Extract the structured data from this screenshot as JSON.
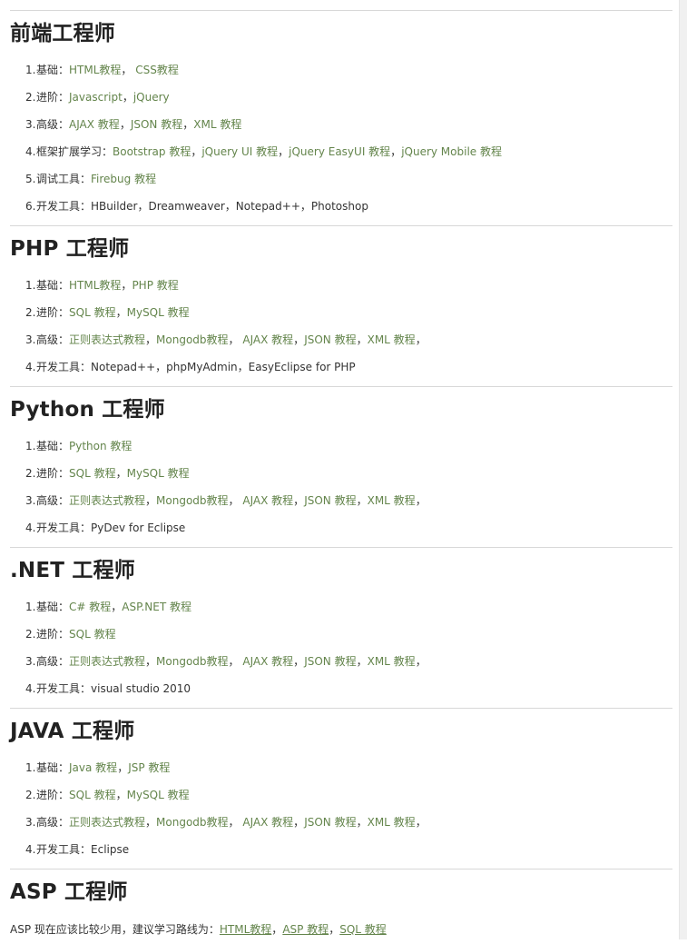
{
  "sections": [
    {
      "title": "前端工程师",
      "items": [
        {
          "num": "1.",
          "label": "基础：",
          "parts": [
            {
              "t": "HTML教程",
              "link": true
            },
            {
              "t": "， ",
              "link": false
            },
            {
              "t": "CSS教程",
              "link": true
            }
          ]
        },
        {
          "num": "2.",
          "label": "进阶：",
          "parts": [
            {
              "t": "Javascript",
              "link": true
            },
            {
              "t": "，",
              "link": false
            },
            {
              "t": "jQuery",
              "link": true
            }
          ]
        },
        {
          "num": "3.",
          "label": "高级：",
          "parts": [
            {
              "t": "AJAX 教程",
              "link": true
            },
            {
              "t": "，",
              "link": false
            },
            {
              "t": "JSON 教程",
              "link": true
            },
            {
              "t": "，",
              "link": false
            },
            {
              "t": "XML 教程",
              "link": true
            }
          ]
        },
        {
          "num": "4.",
          "label": "框架扩展学习：",
          "parts": [
            {
              "t": "Bootstrap 教程",
              "link": true
            },
            {
              "t": "，",
              "link": false
            },
            {
              "t": "jQuery UI 教程",
              "link": true
            },
            {
              "t": "，",
              "link": false
            },
            {
              "t": "jQuery EasyUI 教程",
              "link": true
            },
            {
              "t": "，",
              "link": false
            },
            {
              "t": "jQuery Mobile 教程",
              "link": true
            }
          ]
        },
        {
          "num": "5.",
          "label": "调试工具：",
          "parts": [
            {
              "t": "Firebug 教程",
              "link": true
            }
          ]
        },
        {
          "num": "6.",
          "label": "开发工具：",
          "parts": [
            {
              "t": "HBuilder，Dreamweaver，Notepad++，Photoshop",
              "link": false
            }
          ]
        }
      ]
    },
    {
      "title": "PHP 工程师",
      "items": [
        {
          "num": "1.",
          "label": "基础：",
          "parts": [
            {
              "t": "HTML教程",
              "link": true
            },
            {
              "t": "，",
              "link": false
            },
            {
              "t": "PHP 教程",
              "link": true
            }
          ]
        },
        {
          "num": "2.",
          "label": "进阶：",
          "parts": [
            {
              "t": "SQL 教程",
              "link": true
            },
            {
              "t": "，",
              "link": false
            },
            {
              "t": "MySQL 教程",
              "link": true
            }
          ]
        },
        {
          "num": "3.",
          "label": "高级：",
          "parts": [
            {
              "t": "正则表达式教程",
              "link": true
            },
            {
              "t": "，",
              "link": false
            },
            {
              "t": "Mongodb教程",
              "link": true
            },
            {
              "t": "， ",
              "link": false
            },
            {
              "t": "AJAX 教程",
              "link": true
            },
            {
              "t": "，",
              "link": false
            },
            {
              "t": "JSON 教程",
              "link": true
            },
            {
              "t": "，",
              "link": false
            },
            {
              "t": "XML 教程",
              "link": true
            },
            {
              "t": "，",
              "link": false
            }
          ]
        },
        {
          "num": "4.",
          "label": "开发工具：",
          "parts": [
            {
              "t": "Notepad++，phpMyAdmin，EasyEclipse for PHP",
              "link": false
            }
          ]
        }
      ]
    },
    {
      "title": "Python 工程师",
      "items": [
        {
          "num": "1.",
          "label": "基础：",
          "parts": [
            {
              "t": "Python 教程",
              "link": true
            }
          ]
        },
        {
          "num": "2.",
          "label": "进阶：",
          "parts": [
            {
              "t": "SQL 教程",
              "link": true
            },
            {
              "t": "，",
              "link": false
            },
            {
              "t": "MySQL 教程",
              "link": true
            }
          ]
        },
        {
          "num": "3.",
          "label": "高级：",
          "parts": [
            {
              "t": "正则表达式教程",
              "link": true
            },
            {
              "t": "，",
              "link": false
            },
            {
              "t": "Mongodb教程",
              "link": true
            },
            {
              "t": "， ",
              "link": false
            },
            {
              "t": "AJAX 教程",
              "link": true
            },
            {
              "t": "，",
              "link": false
            },
            {
              "t": "JSON 教程",
              "link": true
            },
            {
              "t": "，",
              "link": false
            },
            {
              "t": "XML 教程",
              "link": true
            },
            {
              "t": "，",
              "link": false
            }
          ]
        },
        {
          "num": "4.",
          "label": "开发工具：",
          "parts": [
            {
              "t": "PyDev for Eclipse",
              "link": false
            }
          ]
        }
      ]
    },
    {
      "title": ".NET 工程师",
      "items": [
        {
          "num": "1.",
          "label": "基础：",
          "parts": [
            {
              "t": "C# 教程",
              "link": true
            },
            {
              "t": "，",
              "link": false
            },
            {
              "t": "ASP.NET 教程",
              "link": true
            }
          ]
        },
        {
          "num": "2.",
          "label": "进阶：",
          "parts": [
            {
              "t": "SQL 教程",
              "link": true
            }
          ]
        },
        {
          "num": "3.",
          "label": "高级：",
          "parts": [
            {
              "t": "正则表达式教程",
              "link": true
            },
            {
              "t": "，",
              "link": false
            },
            {
              "t": "Mongodb教程",
              "link": true
            },
            {
              "t": "， ",
              "link": false
            },
            {
              "t": "AJAX 教程",
              "link": true
            },
            {
              "t": "，",
              "link": false
            },
            {
              "t": "JSON 教程",
              "link": true
            },
            {
              "t": "，",
              "link": false
            },
            {
              "t": "XML 教程",
              "link": true
            },
            {
              "t": "，",
              "link": false
            }
          ]
        },
        {
          "num": "4.",
          "label": "开发工具：",
          "parts": [
            {
              "t": "visual studio 2010",
              "link": false
            }
          ]
        }
      ]
    },
    {
      "title": "JAVA 工程师",
      "items": [
        {
          "num": "1.",
          "label": "基础：",
          "parts": [
            {
              "t": "Java 教程",
              "link": true
            },
            {
              "t": "，",
              "link": false
            },
            {
              "t": "JSP 教程",
              "link": true
            }
          ]
        },
        {
          "num": "2.",
          "label": "进阶：",
          "parts": [
            {
              "t": "SQL 教程",
              "link": true
            },
            {
              "t": "，",
              "link": false
            },
            {
              "t": "MySQL 教程",
              "link": true
            }
          ]
        },
        {
          "num": "3.",
          "label": "高级：",
          "parts": [
            {
              "t": "正则表达式教程",
              "link": true
            },
            {
              "t": "，",
              "link": false
            },
            {
              "t": "Mongodb教程",
              "link": true
            },
            {
              "t": "， ",
              "link": false
            },
            {
              "t": "AJAX 教程",
              "link": true
            },
            {
              "t": "，",
              "link": false
            },
            {
              "t": "JSON 教程",
              "link": true
            },
            {
              "t": "，",
              "link": false
            },
            {
              "t": "XML 教程",
              "link": true
            },
            {
              "t": "，",
              "link": false
            }
          ]
        },
        {
          "num": "4.",
          "label": "开发工具：",
          "parts": [
            {
              "t": "Eclipse",
              "link": false
            }
          ]
        }
      ]
    }
  ],
  "asp": {
    "title": "ASP 工程师",
    "intro": "ASP 现在应该比较少用，建议学习路线为：",
    "links": [
      "HTML教程",
      "ASP 教程",
      "SQL 教程"
    ],
    "sep": "，"
  },
  "colors": {
    "link": "#64854c",
    "text": "#333333",
    "heading": "#222222",
    "rule": "#d8d8d8"
  }
}
